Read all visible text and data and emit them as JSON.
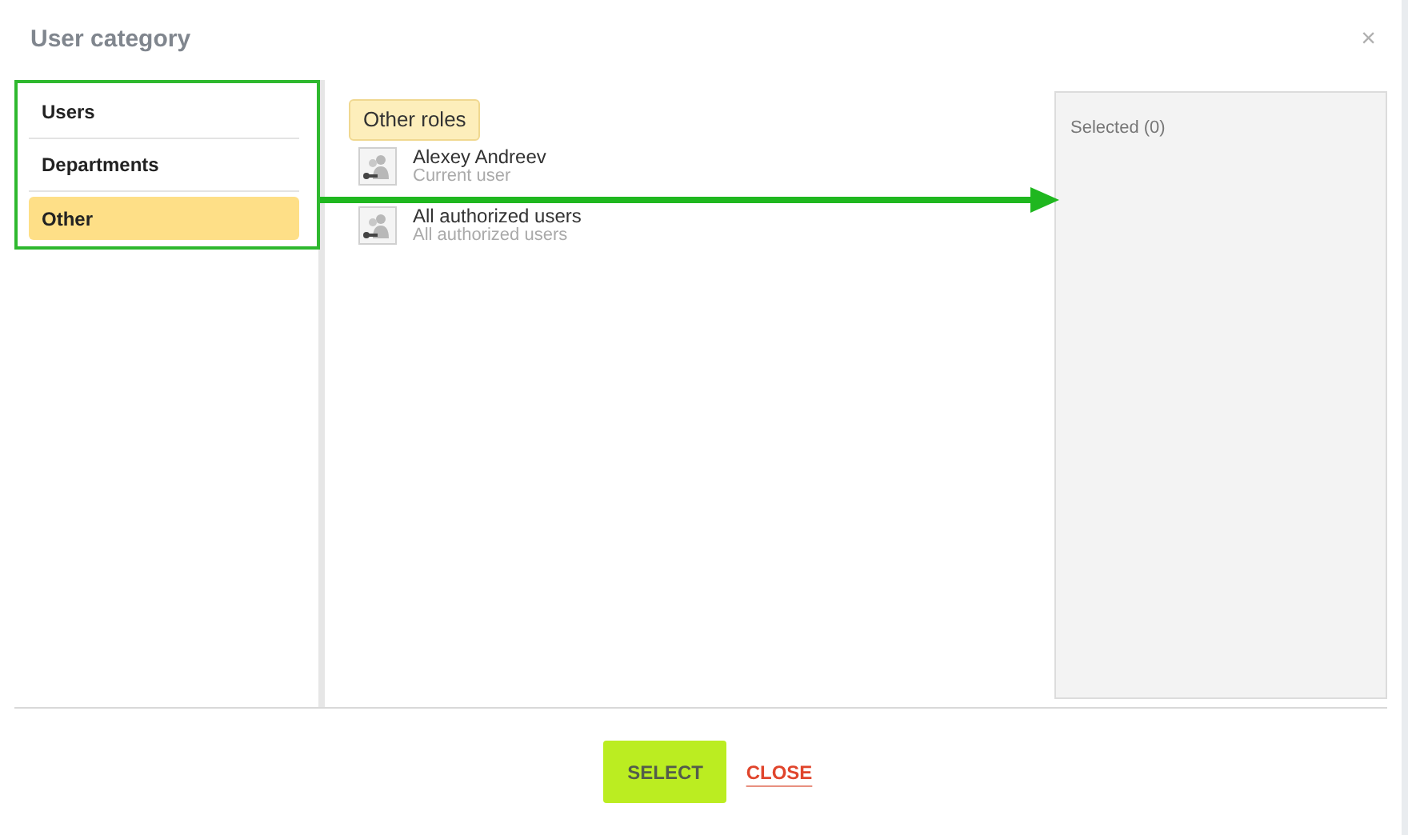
{
  "dialog": {
    "title": "User category",
    "close_glyph": "×"
  },
  "categories": [
    {
      "label": "Users",
      "selected": false
    },
    {
      "label": "Departments",
      "selected": false
    },
    {
      "label": "Other",
      "selected": true
    }
  ],
  "group_label": "Other roles",
  "items": [
    {
      "name": "Alexey Andreev",
      "subtitle": "Current user"
    },
    {
      "name": "All authorized users",
      "subtitle": "All authorized users"
    }
  ],
  "selected_panel": {
    "title": "Selected (0)"
  },
  "buttons": [
    {
      "label": "SELECT",
      "kind": "primary"
    },
    {
      "label": "CLOSE",
      "kind": "link"
    }
  ]
}
